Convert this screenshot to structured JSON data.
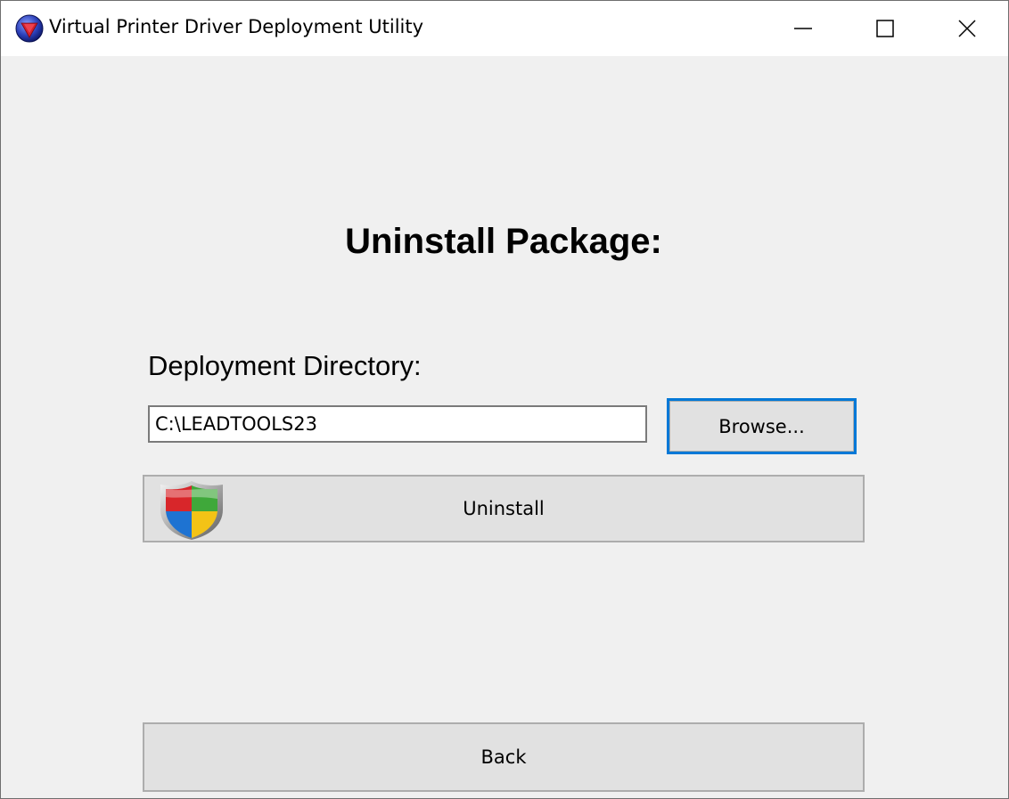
{
  "window": {
    "title": "Virtual Printer Driver Deployment Utility",
    "app_icon": "app-logo-icon",
    "controls": {
      "minimize": "minimize-icon",
      "maximize": "maximize-icon",
      "close": "close-icon"
    }
  },
  "main": {
    "heading": "Uninstall Package:",
    "directory_label": "Deployment Directory:",
    "directory_value": "C:\\LEADTOOLS23",
    "browse_label": "Browse...",
    "uninstall_label": "Uninstall",
    "uninstall_icon": "shield-icon",
    "back_label": "Back"
  },
  "colors": {
    "focus_border": "#0078d7",
    "button_face": "#e1e1e1",
    "window_bg": "#f0f0f0"
  }
}
